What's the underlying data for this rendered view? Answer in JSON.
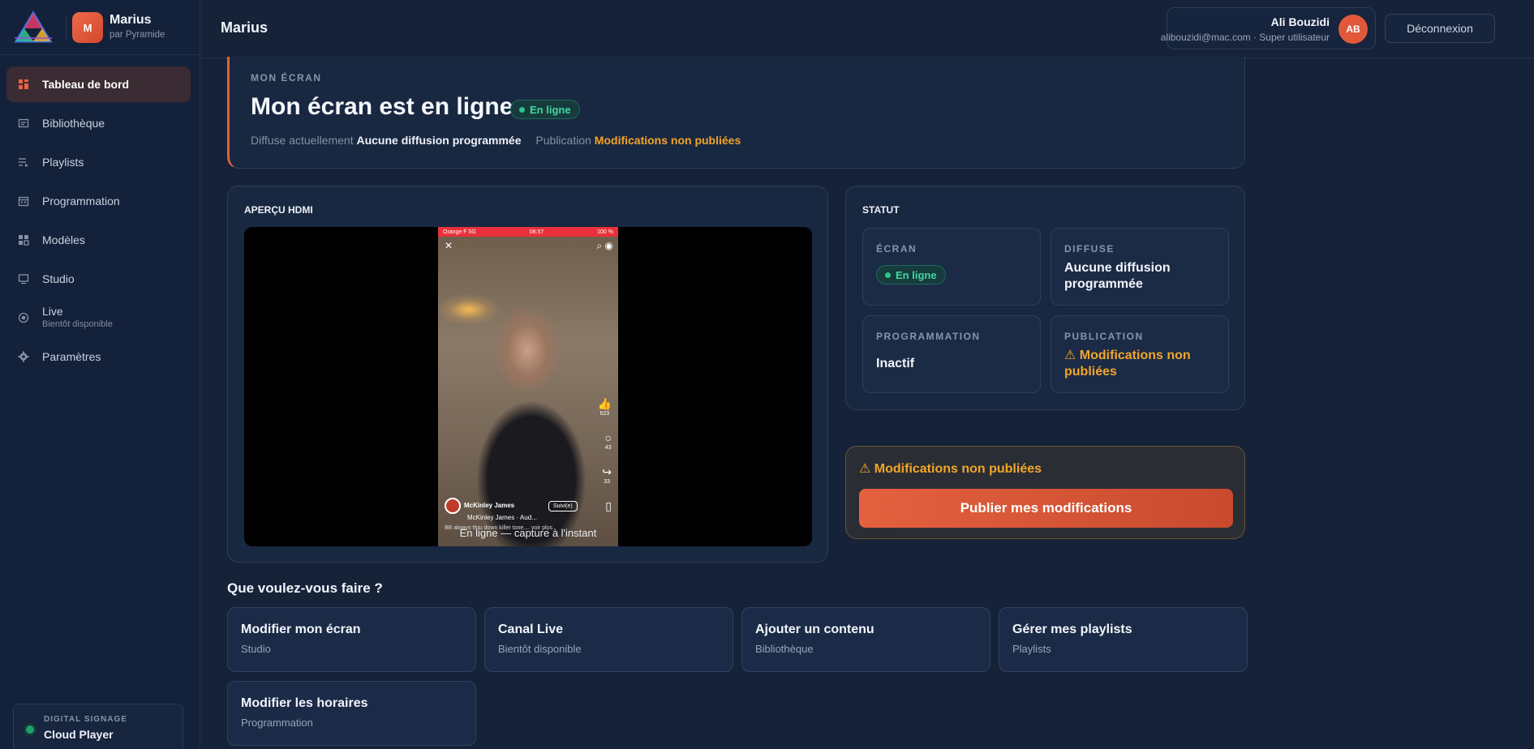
{
  "brand": {
    "name": "Marius",
    "sub": "par Pyramide",
    "avatar": "M"
  },
  "nav": [
    {
      "label": "Tableau de bord",
      "icon": "dashboard-icon",
      "active": true
    },
    {
      "label": "Bibliothèque",
      "icon": "library-icon"
    },
    {
      "label": "Playlists",
      "icon": "playlist-icon"
    },
    {
      "label": "Programmation",
      "icon": "calendar-icon"
    },
    {
      "label": "Modèles",
      "icon": "templates-icon"
    },
    {
      "label": "Studio",
      "icon": "monitor-icon"
    },
    {
      "label": "Live",
      "sub": "Bientôt disponible",
      "icon": "live-icon"
    },
    {
      "label": "Paramètres",
      "icon": "gear-icon"
    }
  ],
  "player": {
    "kicker": "DIGITAL SIGNAGE",
    "name": "Cloud Player"
  },
  "topbar": {
    "title": "Marius",
    "user_name": "Ali Bouzidi",
    "user_meta": "alibouzidi@mac.com · Super utilisateur",
    "user_initials": "AB",
    "logout": "Déconnexion"
  },
  "hero": {
    "kicker": "MON ÉCRAN",
    "title": "Mon écran est en ligne",
    "badge": "En ligne",
    "now_label": "Diffuse actuellement",
    "now_value": "Aucune diffusion programmée",
    "pub_label": "Publication",
    "pub_value": "Modifications non publiées"
  },
  "preview": {
    "title": "APERÇU HDMI",
    "caption": "En ligne — capture à l'instant",
    "phone": {
      "carrier": "Orange F  5G",
      "time": "08:57",
      "battery": "100 %",
      "likes": "623",
      "comments": "43",
      "shares": "33",
      "user": "McKinley James",
      "user_sub": "McKinley James · Aud...",
      "follow": "Suivi(e)",
      "caption": "BB always thru down killer tone.... voir plus"
    }
  },
  "status": {
    "title": "STATUT",
    "tiles": [
      {
        "label": "ÉCRAN",
        "badge": "En ligne"
      },
      {
        "label": "DIFFUSE",
        "value": "Aucune diffusion programmée"
      },
      {
        "label": "PROGRAMMATION",
        "value": "Inactif"
      },
      {
        "label": "PUBLICATION",
        "value": "⚠ Modifications non publiées"
      }
    ]
  },
  "publish": {
    "title": "⚠ Modifications non publiées",
    "button": "Publier mes modifications"
  },
  "actions_title": "Que voulez-vous faire ?",
  "actions": [
    {
      "title": "Modifier mon écran",
      "sub": "Studio"
    },
    {
      "title": "Canal Live",
      "sub": "Bientôt disponible"
    },
    {
      "title": "Ajouter un contenu",
      "sub": "Bibliothèque"
    },
    {
      "title": "Gérer mes playlists",
      "sub": "Playlists"
    },
    {
      "title": "Modifier les horaires",
      "sub": "Programmation"
    }
  ],
  "colors": {
    "accent": "#e4613f",
    "online": "#41d8a0",
    "warning": "#f3a52a"
  }
}
